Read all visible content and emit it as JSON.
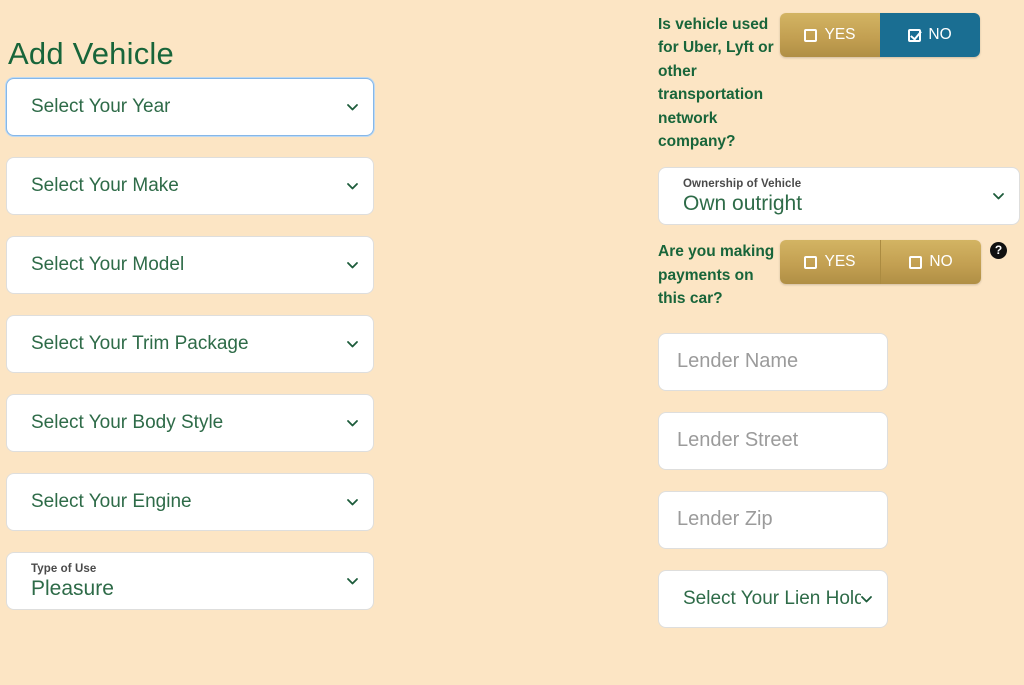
{
  "theme": {
    "background": "#fce5c4",
    "accent_green": "#18653a",
    "gold": "#c3a052",
    "teal": "#1a6e92",
    "field_bg": "#ffffff",
    "field_border": "#dededd",
    "focus_border": "#86b7e8",
    "placeholder_grey": "#9b9b9b"
  },
  "left": {
    "title": "Add Vehicle",
    "selects": [
      {
        "placeholder": "Select Your Year",
        "focused": true
      },
      {
        "placeholder": "Select Your Make",
        "focused": false
      },
      {
        "placeholder": "Select Your Model",
        "focused": false
      },
      {
        "placeholder": "Select Your Trim Package",
        "focused": false
      },
      {
        "placeholder": "Select Your Body Style",
        "focused": false
      },
      {
        "placeholder": "Select Your Engine",
        "focused": false
      }
    ],
    "type_of_use": {
      "label": "Type of Use",
      "value": "Pleasure"
    }
  },
  "right": {
    "question_tnc": {
      "label": "Is vehicle used for Uber, Lyft or other transportation network company?",
      "yes_label": "YES",
      "no_label": "NO",
      "selected": "NO"
    },
    "ownership": {
      "label": "Ownership of Vehicle",
      "value": "Own outright"
    },
    "question_payments": {
      "label": "Are you making payments on this car?",
      "yes_label": "YES",
      "no_label": "NO",
      "selected": "",
      "help_glyph": "?"
    },
    "lender_fields": [
      {
        "placeholder": "Lender Name"
      },
      {
        "placeholder": "Lender Street"
      },
      {
        "placeholder": "Lender Zip"
      }
    ],
    "lien_holder": {
      "placeholder": "Select Your Lien Holder"
    }
  }
}
